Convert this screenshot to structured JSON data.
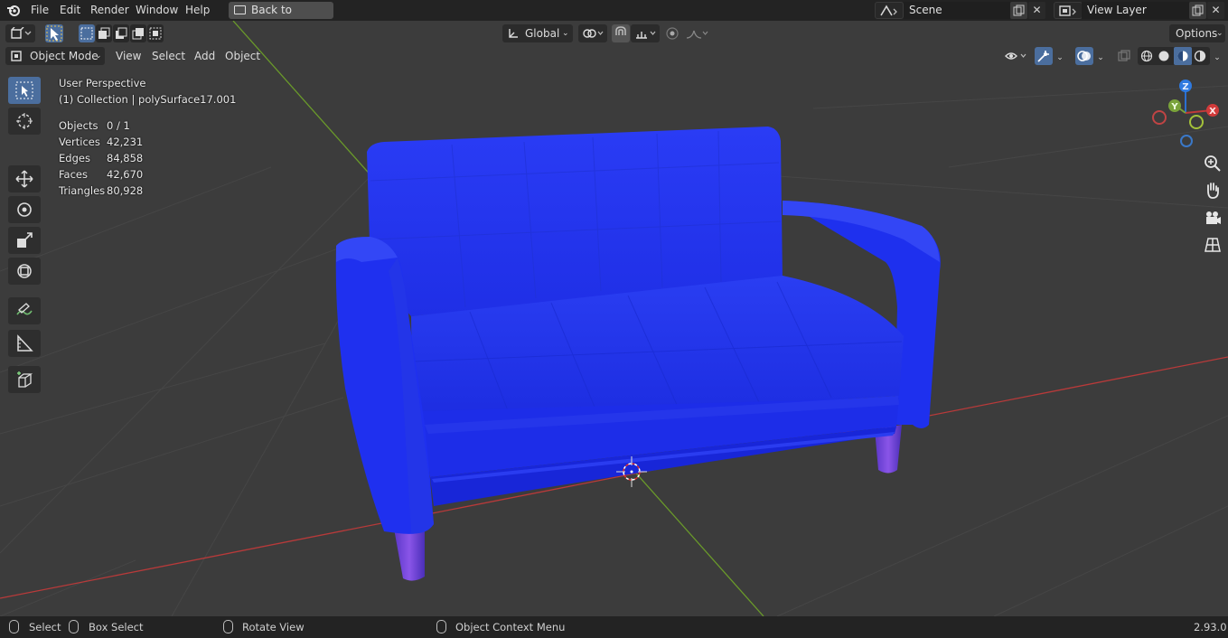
{
  "menubar": {
    "items": [
      "File",
      "Edit",
      "Render",
      "Window",
      "Help"
    ],
    "back_button": "Back to Previous",
    "scene_label": "Scene",
    "view_layer_label": "View Layer"
  },
  "header": {
    "transform_orientation": "Global",
    "options_label": "Options",
    "mode_label": "Object Mode",
    "menus": [
      "View",
      "Select",
      "Add",
      "Object"
    ]
  },
  "overlay": {
    "view_name": "User Perspective",
    "collection_info": "(1) Collection | polySurface17.001",
    "stats": [
      {
        "label": "Objects",
        "value": "0 / 1"
      },
      {
        "label": "Vertices",
        "value": "42,231"
      },
      {
        "label": "Edges",
        "value": "84,858"
      },
      {
        "label": "Faces",
        "value": "42,670"
      },
      {
        "label": "Triangles",
        "value": "80,928"
      }
    ]
  },
  "gizmo": {
    "z": "Z",
    "y": "Y",
    "x": "X"
  },
  "statusbar": {
    "select": "Select",
    "box_select": "Box Select",
    "rotate_view": "Rotate View",
    "context_menu": "Object Context Menu",
    "version": "2.93.0"
  },
  "colors": {
    "sofa": "#1f2ff0",
    "legs": "#6a3fd8",
    "x_axis": "#b83a3a",
    "y_axis": "#6a9a2a",
    "selected": "#4b6e9e"
  }
}
